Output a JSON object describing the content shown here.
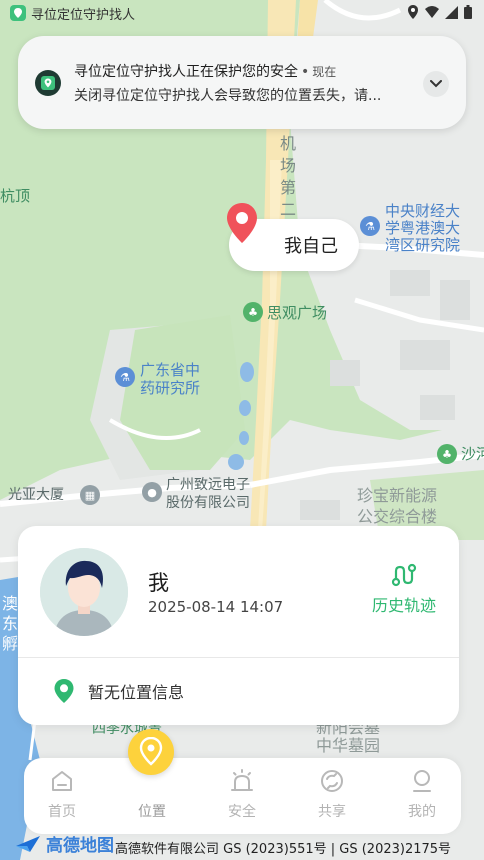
{
  "status_bar": {
    "app_name": "寻位定位守护找人"
  },
  "notification": {
    "title": "寻位定位守护找人正在保护您的安全",
    "separator": "•",
    "time": "现在",
    "body": "关闭寻位定位守护找人会导致您的位置丢失，请..."
  },
  "map": {
    "my_marker_label": "我自己",
    "labels": {
      "top_left_partial": "杭顶",
      "road_vertical": "机场第二",
      "cufe_line1": "中央财经大",
      "cufe_line2": "学粤港澳大",
      "cufe_line3": "湾区研究院",
      "siguan_square": "思观广场",
      "gd_tcm_line1": "广东省中",
      "gd_tcm_line2": "药研究所",
      "shahe": "沙河",
      "guangya": "光亚大厦",
      "zhiyuan_line1": "广州致远电子",
      "zhiyuan_line2": "股份有限公司",
      "zhenbao_line1": "珍宝新能源",
      "zhenbao_line2": "公交综合楼",
      "left_partial_1": "澳",
      "left_partial_2": "东",
      "left_partial_3": "孵",
      "bottom_partial_1": "四季水城景",
      "bottom_partial_2": "新阳会墓",
      "bottom_partial_3": "中华墓园"
    }
  },
  "profile_card": {
    "name": "我",
    "timestamp": "2025-08-14 14:07",
    "history_button": "历史轨迹",
    "location_status": "暂无位置信息"
  },
  "bottom_nav": {
    "items": [
      {
        "label": "首页",
        "icon": "home-icon"
      },
      {
        "label": "位置",
        "icon": "location-pin-icon"
      },
      {
        "label": "安全",
        "icon": "alarm-icon"
      },
      {
        "label": "共享",
        "icon": "share-icon"
      },
      {
        "label": "我的",
        "icon": "profile-icon"
      }
    ],
    "active_index": 1
  },
  "footer": {
    "amap_logo_text": "高德地图",
    "copyright": "高德软件有限公司  GS (2023)551号 | GS (2023)2175号"
  },
  "colors": {
    "accent_green": "#2fb871",
    "marker_red": "#f0525a",
    "active_nav_yellow": "#fdd23c",
    "map_green": "#c9e5bf"
  }
}
